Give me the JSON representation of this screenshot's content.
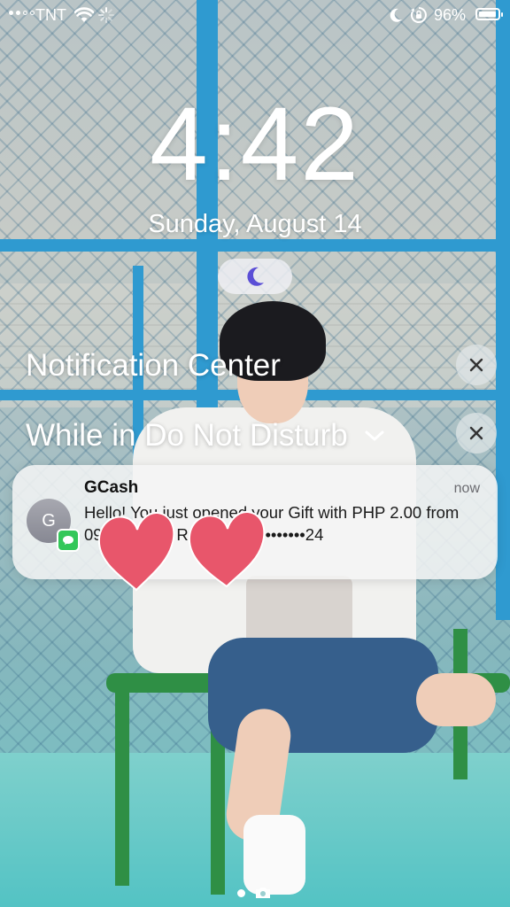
{
  "status_bar": {
    "carrier": "TNT",
    "battery_percent": "96%",
    "battery_level": 0.96,
    "icons": [
      "signal-dots-icon",
      "wifi-icon",
      "loading-spinner-icon",
      "moon-icon",
      "orientation-lock-icon",
      "battery-icon"
    ]
  },
  "lock_screen": {
    "time": "4:42",
    "date": "Sunday, August 14",
    "focus_icon": "moon-icon"
  },
  "notification_center": {
    "title": "Notification Center",
    "dnd_section_title": "While in Do Not Disturb"
  },
  "notification": {
    "avatar_initial": "G",
    "app_icon": "messages-icon",
    "title": "GCash",
    "time": "now",
    "body": "Hello! You just opened your Gift with PHP 2.00 from 0917•••••82! Ref. No. 14••••••••24"
  },
  "overlay": {
    "stickers": [
      "heart-sticker",
      "heart-sticker"
    ]
  },
  "colors": {
    "heart": "#e8566b",
    "moon_accent": "#5b4fd6",
    "messages_green": "#34c759"
  }
}
